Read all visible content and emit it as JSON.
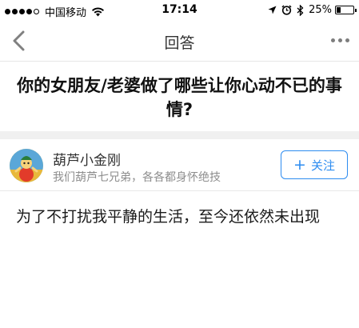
{
  "status_bar": {
    "carrier": "中国移动",
    "time": "17:14",
    "battery_percent": "25%",
    "battery_level": 0.25,
    "signal_bars_filled": 4,
    "signal_bars_total": 5,
    "icons": [
      "wifi-icon",
      "location-icon",
      "alarm-icon",
      "bluetooth-icon",
      "battery-icon"
    ]
  },
  "nav": {
    "title": "回答",
    "back_icon": "back-chevron-icon",
    "more_icon": "more-dots-icon"
  },
  "question": {
    "title": "你的女朋友/老婆做了哪些让你心动不已的事情?"
  },
  "author": {
    "name": "葫芦小金刚",
    "bio": "我们葫芦七兄弟，各各都身怀绝技",
    "follow_label": "关注",
    "follow_icon": "plus-icon"
  },
  "answer": {
    "text": "为了不打扰我平静的生活，至今还依然未出现"
  },
  "colors": {
    "accent": "#2d8cf0",
    "divider": "#f0f0f0",
    "secondary_text": "#8d8d8d"
  }
}
